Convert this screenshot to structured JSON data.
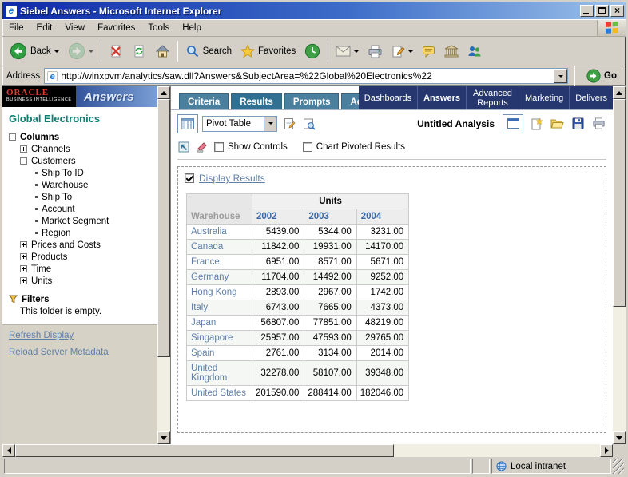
{
  "window": {
    "title": "Siebel Answers - Microsoft Internet Explorer"
  },
  "menubar": {
    "items": [
      "File",
      "Edit",
      "View",
      "Favorites",
      "Tools",
      "Help"
    ]
  },
  "toolbar": {
    "back_label": "Back",
    "search_label": "Search",
    "favorites_label": "Favorites"
  },
  "addressbar": {
    "label": "Address",
    "url": "http://winxpvm/analytics/saw.dll?Answers&SubjectArea=%22Global%20Electronics%22",
    "go_label": "Go"
  },
  "branding": {
    "oracle": "ORACLE",
    "oracle_sub": "BUSINESS INTELLIGENCE",
    "product": "Answers"
  },
  "sidebar": {
    "title": "Global Electronics",
    "root_label": "Columns",
    "nodes": [
      {
        "label": "Channels"
      },
      {
        "label": "Customers"
      },
      {
        "label": "Prices and Costs"
      },
      {
        "label": "Products"
      },
      {
        "label": "Time"
      },
      {
        "label": "Units"
      }
    ],
    "customers_children": [
      "Ship To ID",
      "Warehouse",
      "Ship To",
      "Account",
      "Market Segment",
      "Region"
    ],
    "filters_label": "Filters",
    "filters_empty": "This folder is empty.",
    "link_refresh": "Refresh Display",
    "link_reload": "Reload Server Metadata"
  },
  "header": {
    "tabs": [
      "Criteria",
      "Results",
      "Prompts",
      "Advanced"
    ],
    "active_tab": "Results",
    "nav": [
      "Dashboards",
      "Answers",
      "Advanced Reports",
      "Marketing",
      "Delivers"
    ]
  },
  "results_toolbar": {
    "view_selector": "Pivot Table",
    "analysis_title": "Untitled Analysis",
    "show_controls_label": "Show Controls",
    "chart_pivoted_label": "Chart Pivoted Results"
  },
  "results": {
    "display_results_label": "Display Results"
  },
  "pivot": {
    "row_dim": "Warehouse",
    "measure": "Units",
    "years": [
      "2002",
      "2003",
      "2004"
    ],
    "rows": [
      {
        "label": "Australia",
        "values": [
          "5439.00",
          "5344.00",
          "3231.00"
        ]
      },
      {
        "label": "Canada",
        "values": [
          "11842.00",
          "19931.00",
          "14170.00"
        ]
      },
      {
        "label": "France",
        "values": [
          "6951.00",
          "8571.00",
          "5671.00"
        ]
      },
      {
        "label": "Germany",
        "values": [
          "11704.00",
          "14492.00",
          "9252.00"
        ]
      },
      {
        "label": "Hong Kong",
        "values": [
          "2893.00",
          "2967.00",
          "1742.00"
        ]
      },
      {
        "label": "Italy",
        "values": [
          "6743.00",
          "7665.00",
          "4373.00"
        ]
      },
      {
        "label": "Japan",
        "values": [
          "56807.00",
          "77851.00",
          "48219.00"
        ]
      },
      {
        "label": "Singapore",
        "values": [
          "25957.00",
          "47593.00",
          "29765.00"
        ]
      },
      {
        "label": "Spain",
        "values": [
          "2761.00",
          "3134.00",
          "2014.00"
        ]
      },
      {
        "label": "United Kingdom",
        "values": [
          "32278.00",
          "58107.00",
          "39348.00"
        ]
      },
      {
        "label": "United States",
        "values": [
          "201590.00",
          "288414.00",
          "182046.00"
        ]
      }
    ]
  },
  "statusbar": {
    "zone": "Local intranet"
  },
  "colors": {
    "titlebar_blue": "#0F2BA8",
    "nav_blue": "#25376E",
    "tab_teal": "#4A7F9E",
    "link_blue": "#5E7FA8",
    "accent_green": "#2E9E40"
  }
}
